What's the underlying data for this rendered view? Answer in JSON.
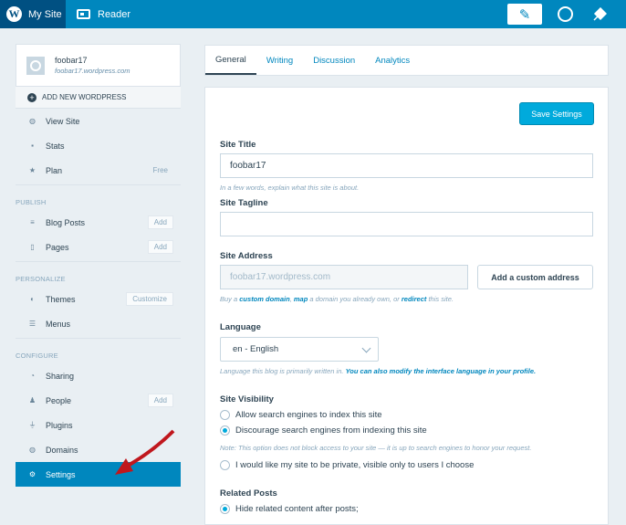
{
  "masterbar": {
    "my_site": "My Site",
    "reader": "Reader",
    "wp_logo_icon": "wordpress-logo-icon",
    "write_icon": "write-post-icon",
    "me_icon": "avatar-icon",
    "notifications_icon": "notifications-icon",
    "accent_color": "#0087be"
  },
  "sidebar": {
    "site": {
      "name": "foobar17",
      "url": "foobar17.wordpress.com"
    },
    "add_new": "ADD NEW WORDPRESS",
    "top_items": [
      {
        "label": "View Site",
        "icon": "globe-icon"
      },
      {
        "label": "Stats",
        "icon": "stats-icon"
      },
      {
        "label": "Plan",
        "icon": "star-icon",
        "note": "Free"
      }
    ],
    "publish": {
      "heading": "Publish",
      "items": [
        {
          "label": "Blog Posts",
          "icon": "posts-icon",
          "badge": "Add"
        },
        {
          "label": "Pages",
          "icon": "page-icon",
          "badge": "Add"
        }
      ]
    },
    "personalize": {
      "heading": "Personalize",
      "items": [
        {
          "label": "Themes",
          "icon": "themes-icon",
          "badge": "Customize"
        },
        {
          "label": "Menus",
          "icon": "menus-icon"
        }
      ]
    },
    "configure": {
      "heading": "Configure",
      "items": [
        {
          "label": "Sharing",
          "icon": "share-icon"
        },
        {
          "label": "People",
          "icon": "person-icon",
          "badge": "Add"
        },
        {
          "label": "Plugins",
          "icon": "plugin-icon"
        },
        {
          "label": "Domains",
          "icon": "domains-icon"
        },
        {
          "label": "Settings",
          "icon": "gear-icon",
          "active": true
        }
      ]
    }
  },
  "tabs": [
    "General",
    "Writing",
    "Discussion",
    "Analytics"
  ],
  "form": {
    "save_label": "Save Settings",
    "site_title_label": "Site Title",
    "site_title_value": "foobar17",
    "site_title_help": "In a few words, explain what this site is about.",
    "tagline_label": "Site Tagline",
    "tagline_value": "",
    "address_label": "Site Address",
    "address_value": "foobar17.wordpress.com",
    "custom_address_button": "Add a custom address",
    "address_help_1": "Buy a ",
    "address_help_link1": "custom domain",
    "address_help_2": ", ",
    "address_help_link2": "map",
    "address_help_3": " a domain you already own, or ",
    "address_help_link3": "redirect",
    "address_help_4": " this site.",
    "language_label": "Language",
    "language_value": "en - English",
    "language_help_1": "Language this blog is primarily written in. ",
    "language_help_link": "You can also modify the interface language in your profile.",
    "visibility_label": "Site Visibility",
    "visibility_options": [
      {
        "label": "Allow search engines to index this site",
        "checked": false
      },
      {
        "label": "Discourage search engines from indexing this site",
        "checked": true
      },
      {
        "label": "I would like my site to be private, visible only to users I choose",
        "checked": false
      }
    ],
    "visibility_note": "Note: This option does not block access to your site — it is up to search engines to honor your request.",
    "related_label": "Related Posts",
    "related_option": "Hide related content after posts;"
  }
}
